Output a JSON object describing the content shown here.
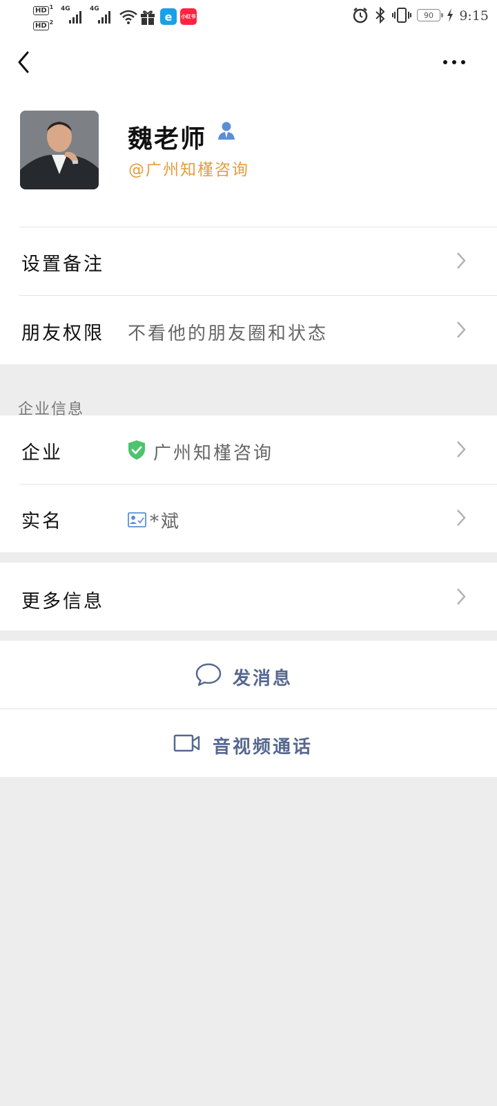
{
  "status_bar": {
    "hd1": "HD",
    "hd1_sub": "1",
    "hd2": "HD",
    "hd2_sub": "2",
    "network1": "4G",
    "network2": "4G",
    "app_badge_1": "e",
    "app_badge_1_color": "#1aa0e8",
    "app_badge_2": "小红书",
    "app_badge_2_color": "#ff2442",
    "battery": "90",
    "time": "9:15"
  },
  "profile": {
    "name": "魏老师",
    "company_tag": "@广州知槿咨询",
    "company_tag_color": "#e59c3a"
  },
  "settings": {
    "remark_label": "设置备注",
    "permission_label": "朋友权限",
    "permission_value": "不看他的朋友圈和状态"
  },
  "enterprise": {
    "section_title": "企业信息",
    "company_label": "企业",
    "company_value": "广州知槿咨询",
    "realname_label": "实名",
    "realname_value": "*斌"
  },
  "more": {
    "label": "更多信息"
  },
  "actions": {
    "message_label": "发消息",
    "call_label": "音视频通话",
    "accent_color": "#56688f"
  },
  "icons": {
    "back": "back-arrow-icon",
    "more": "more-dots-icon",
    "verified": "person-icon",
    "shield": "shield-check-icon",
    "card": "id-card-icon",
    "chat": "chat-bubble-icon",
    "video": "video-camera-icon"
  }
}
